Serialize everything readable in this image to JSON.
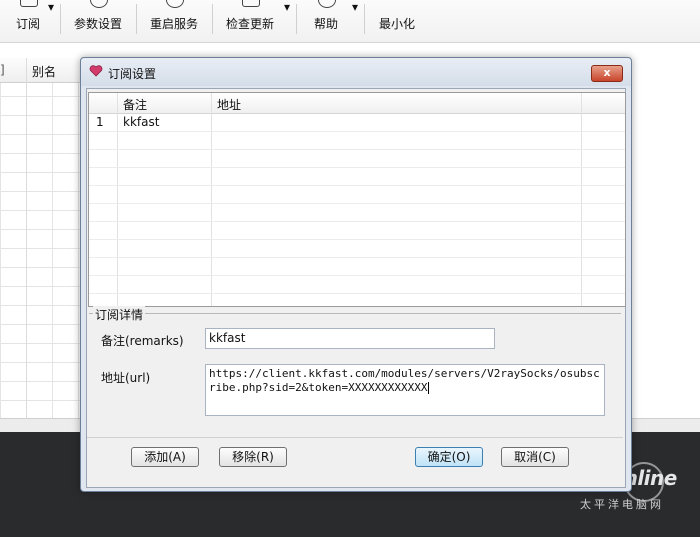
{
  "toolbar": {
    "items": [
      {
        "label": "订阅",
        "has_dropdown": true
      },
      {
        "label": "参数设置",
        "has_dropdown": false
      },
      {
        "label": "重启服务",
        "has_dropdown": false
      },
      {
        "label": "检查更新",
        "has_dropdown": true
      },
      {
        "label": "帮助",
        "has_dropdown": true
      },
      {
        "label": "最小化",
        "has_dropdown": false
      }
    ]
  },
  "main_list": {
    "columns": [
      "别名"
    ]
  },
  "dialog": {
    "title": "订阅设置",
    "close_label": "x",
    "list": {
      "columns": [
        "备注",
        "地址"
      ],
      "rows": [
        {
          "index": "1",
          "remark": "kkfast",
          "address": ""
        }
      ]
    },
    "details": {
      "group_title": "订阅详情",
      "remark_label": "备注(remarks)",
      "remark_value": "kkfast",
      "url_label": "地址(url)",
      "url_value": "https://client.kkfast.com/modules/servers/V2raySocks/osubscribe.php?sid=2&token=XXXXXXXXXXXX"
    },
    "buttons": {
      "add": "添加(A)",
      "remove": "移除(R)",
      "ok": "确定(O)",
      "cancel": "取消(C)"
    }
  },
  "watermark": {
    "brand": "PConline",
    "subtitle": "太平洋电脑网"
  },
  "colors": {
    "dialog_frame": "#dfe6ef",
    "close_button": "#c8452c",
    "taskbar": "#2a2b2d"
  }
}
